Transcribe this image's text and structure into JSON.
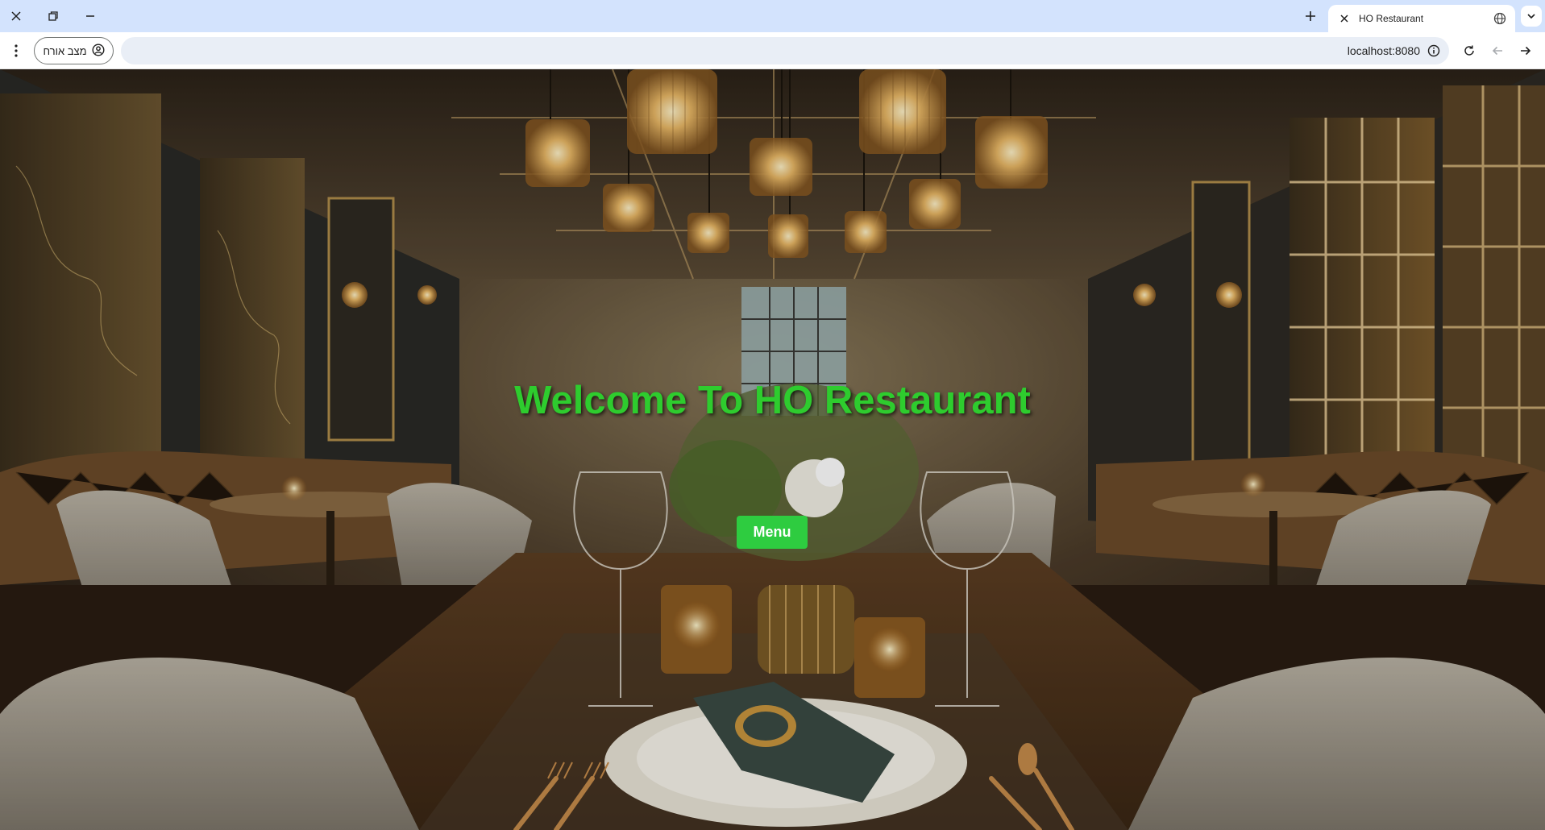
{
  "browser": {
    "tab": {
      "title": "HO Restaurant"
    },
    "profile": {
      "label": "מצב אורח"
    },
    "address_bar": {
      "url": "localhost:8080"
    }
  },
  "page": {
    "hero": {
      "title": "Welcome To HO Restaurant"
    },
    "menu_button": {
      "label": "Menu"
    },
    "colors": {
      "title_green": "#2ecc2e",
      "button_green": "#2ecc40"
    },
    "background_image": "restaurant-interior-photo"
  }
}
